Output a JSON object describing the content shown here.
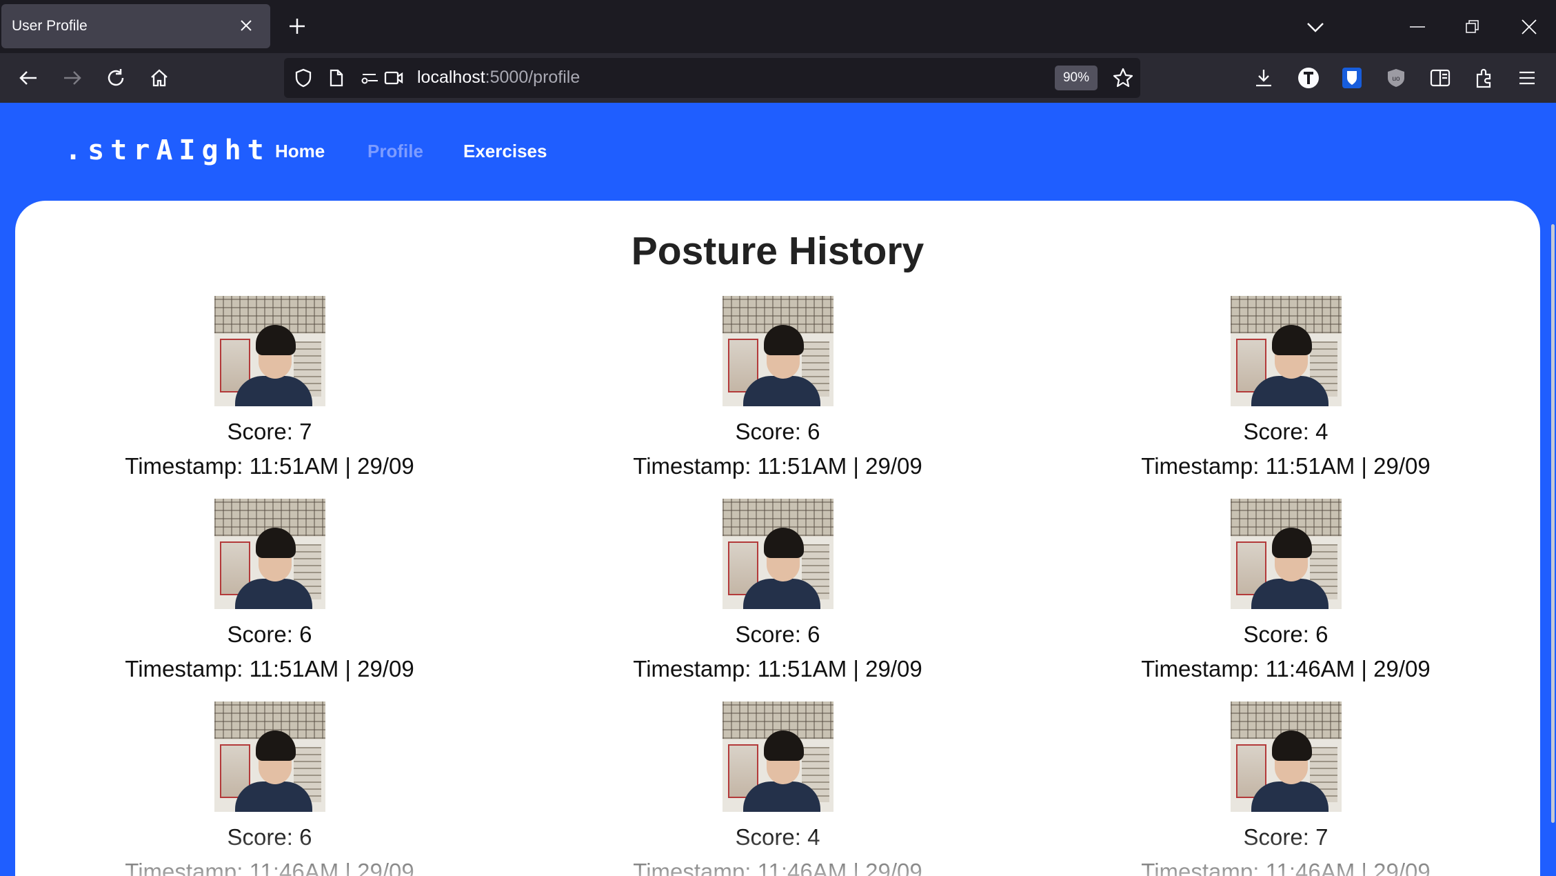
{
  "browser": {
    "tab_title": "User Profile",
    "url_host": "localhost",
    "url_path": ":5000/profile",
    "zoom": "90%"
  },
  "site": {
    "logo": ".strAIght",
    "nav": [
      {
        "label": "Home",
        "active": false
      },
      {
        "label": "Profile",
        "active": true
      },
      {
        "label": "Exercises",
        "active": false
      }
    ]
  },
  "page": {
    "title": "Posture History",
    "entries": [
      {
        "score": "Score: 7",
        "timestamp": "Timestamp: 11:51AM | 29/09"
      },
      {
        "score": "Score: 6",
        "timestamp": "Timestamp: 11:51AM | 29/09"
      },
      {
        "score": "Score: 4",
        "timestamp": "Timestamp: 11:51AM | 29/09"
      },
      {
        "score": "Score: 6",
        "timestamp": "Timestamp: 11:51AM | 29/09"
      },
      {
        "score": "Score: 6",
        "timestamp": "Timestamp: 11:51AM | 29/09"
      },
      {
        "score": "Score: 6",
        "timestamp": "Timestamp: 11:46AM | 29/09"
      },
      {
        "score": "Score: 6",
        "timestamp": "Timestamp: 11:46AM | 29/09"
      },
      {
        "score": "Score: 4",
        "timestamp": "Timestamp: 11:46AM | 29/09"
      },
      {
        "score": "Score: 7",
        "timestamp": "Timestamp: 11:46AM | 29/09"
      }
    ]
  },
  "colors": {
    "brand_blue": "#1f5eff",
    "chrome_dark": "#1c1b22",
    "chrome_toolbar": "#2b2a33"
  }
}
